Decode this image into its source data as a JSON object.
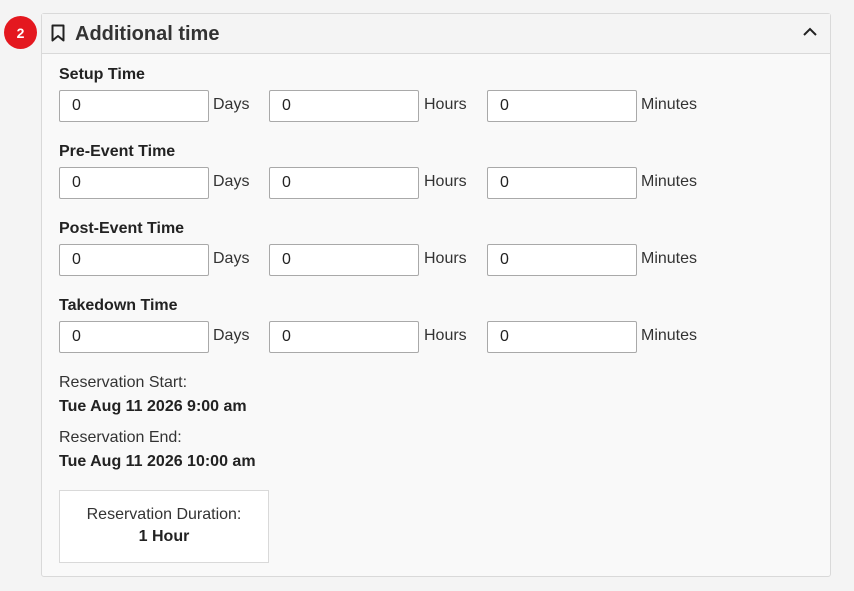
{
  "step_badge": "2",
  "section": {
    "title": "Additional time",
    "icon": "bookmark-icon",
    "collapse_icon": "chevron-up-icon"
  },
  "units": {
    "days": "Days",
    "hours": "Hours",
    "minutes": "Minutes"
  },
  "fields": [
    {
      "label": "Setup Time",
      "days": "0",
      "hours": "0",
      "minutes": "0"
    },
    {
      "label": "Pre-Event Time",
      "days": "0",
      "hours": "0",
      "minutes": "0"
    },
    {
      "label": "Post-Event Time",
      "days": "0",
      "hours": "0",
      "minutes": "0"
    },
    {
      "label": "Takedown Time",
      "days": "0",
      "hours": "0",
      "minutes": "0"
    }
  ],
  "reservation": {
    "start_label": "Reservation Start:",
    "start_value": "Tue Aug 11 2026 9:00 am",
    "end_label": "Reservation End:",
    "end_value": "Tue Aug 11 2026 10:00 am",
    "duration_label": "Reservation Duration:",
    "duration_value": "1 Hour"
  },
  "colors": {
    "badge": "#e4181f",
    "panel_bg": "#f9f9f9",
    "border": "#d9d9d9"
  }
}
